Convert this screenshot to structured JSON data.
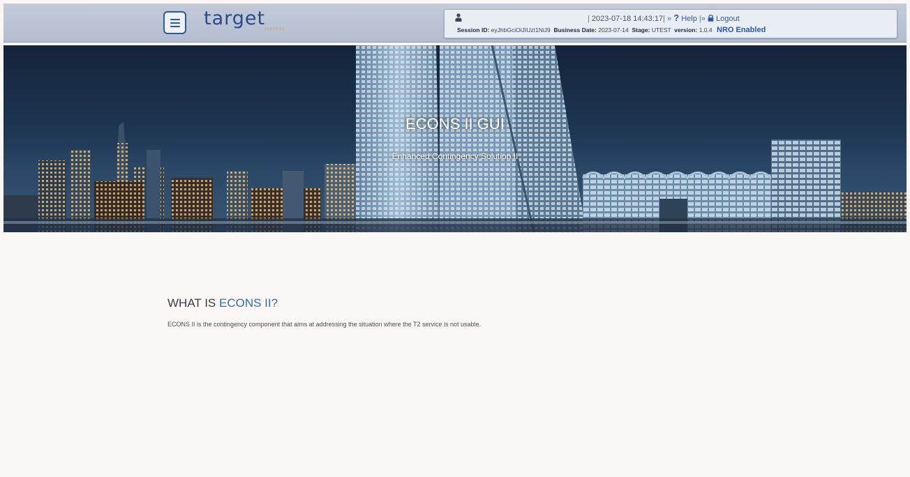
{
  "header": {
    "logo_text": "target",
    "logo_subtext": "SERVICES",
    "menu_icon": "hamburger-menu-icon",
    "user_icon": "user-icon",
    "datetime": "2023-07-18 14:43:17",
    "help_label": "Help",
    "logout_label": "Logout",
    "session_label": "Session ID:",
    "session_value": "eyJhbGciOiJIUzI1NiJ9",
    "business_date_label": "Business Date:",
    "business_date_value": "2023-07-14",
    "stage_label": "Stage:",
    "stage_value": "UTEST",
    "version_label": "version:",
    "version_value": "1.0.4",
    "nro_status": "NRO Enabled"
  },
  "banner": {
    "title": "ECONS II GUI",
    "subtitle": "Enhanced Contingency Solution II"
  },
  "main": {
    "heading_prefix": "WHAT IS ",
    "heading_accent": "ECONS II?",
    "description": "ECONS II is the contingency component that aims at addressing the situation where the T2 service is not usable."
  },
  "colors": {
    "accent": "#3470b4",
    "header_bg": "#b9c3d4",
    "page_bg": "#fbf7f6"
  }
}
